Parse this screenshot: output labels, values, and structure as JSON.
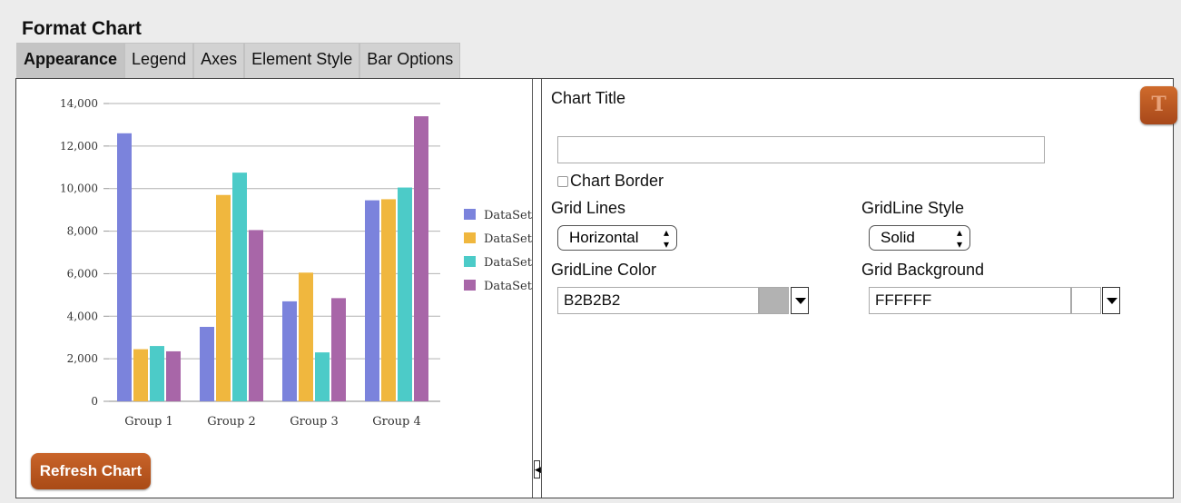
{
  "title": "Format Chart",
  "tabs": [
    "Appearance",
    "Legend",
    "Axes",
    "Element Style",
    "Bar Options"
  ],
  "active_tab": "Appearance",
  "refresh_label": "Refresh Chart",
  "splitter_icon": "◀",
  "form": {
    "chart_title_label": "Chart Title",
    "chart_title_value": "",
    "title_button_glyph": "T",
    "chart_border_label": "Chart Border",
    "chart_border_checked": false,
    "grid_lines_label": "Grid Lines",
    "grid_lines_value": "Horizontal",
    "gridline_style_label": "GridLine Style",
    "gridline_style_value": "Solid",
    "gridline_color_label": "GridLine Color",
    "gridline_color_value": "B2B2B2",
    "grid_background_label": "Grid Background",
    "grid_background_value": "FFFFFF",
    "select_arrows": "▲▼"
  },
  "colors": {
    "gridline": "#B2B2B2",
    "grid_background": "#FFFFFF",
    "accent_button": "#B8541F"
  },
  "chart_data": {
    "type": "bar",
    "categories": [
      "Group 1",
      "Group 2",
      "Group 3",
      "Group 4"
    ],
    "series": [
      {
        "name": "DataSet",
        "color": "#7b83dc",
        "values": [
          12600,
          3500,
          4700,
          9450
        ]
      },
      {
        "name": "DataSet",
        "color": "#f0b73e",
        "values": [
          2450,
          9700,
          6050,
          9500
        ]
      },
      {
        "name": "DataSet",
        "color": "#4ccbc8",
        "values": [
          2600,
          10750,
          2300,
          10050
        ]
      },
      {
        "name": "DataSet",
        "color": "#a866a8",
        "values": [
          2350,
          8050,
          4850,
          13400
        ]
      }
    ],
    "yticks": [
      "0",
      "2,000",
      "4,000",
      "6,000",
      "8,000",
      "10,000",
      "12,000",
      "14,000"
    ],
    "ylim": [
      0,
      14000
    ],
    "grid": true,
    "legend_position": "right"
  }
}
